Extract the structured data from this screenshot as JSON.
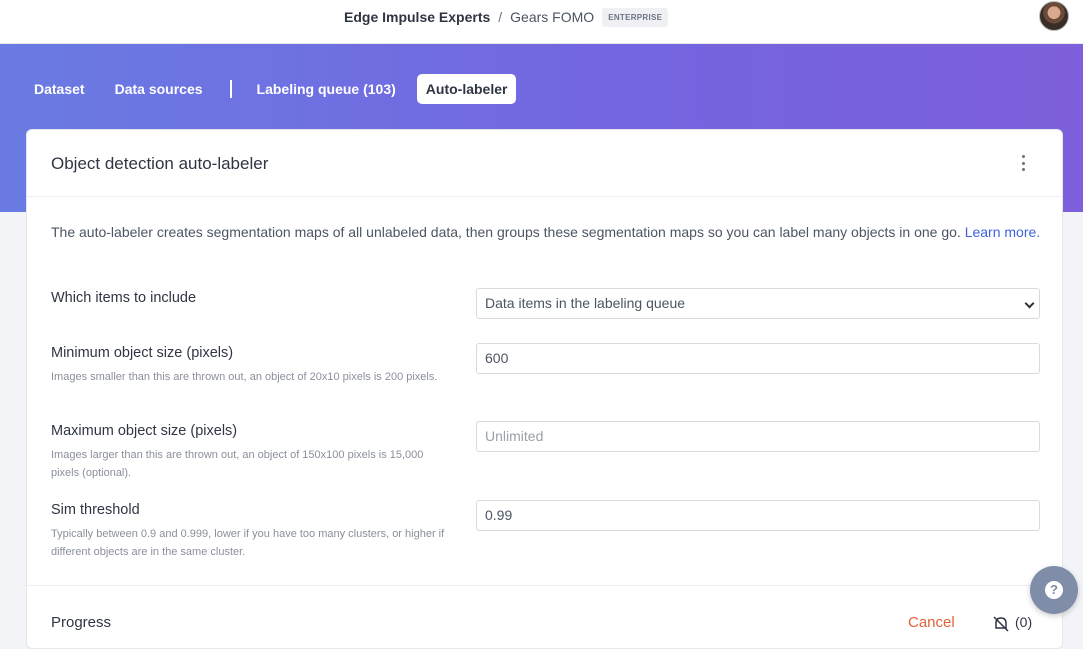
{
  "header": {
    "org_name": "Edge Impulse Experts",
    "separator": "/",
    "project_name": "Gears FOMO",
    "plan_badge": "ENTERPRISE",
    "avatar_icon": "user-avatar"
  },
  "tabs": [
    {
      "label": "Dataset",
      "active": false
    },
    {
      "label": "Data sources",
      "active": false
    },
    {
      "label": "Labeling queue (103)",
      "active": false
    },
    {
      "label": "Auto-labeler",
      "active": true
    }
  ],
  "card": {
    "title": "Object detection auto-labeler",
    "menu_icon": "kebab-menu-icon",
    "description": "The auto-labeler creates segmentation maps of all unlabeled data, then groups these segmentation maps so you can label many objects in one go.",
    "learn_more": "Learn more."
  },
  "form": {
    "include": {
      "label": "Which items to include",
      "value": "Data items in the labeling queue"
    },
    "min_size": {
      "label": "Minimum object size (pixels)",
      "help": "Images smaller than this are thrown out, an object of 20x10 pixels is 200 pixels.",
      "value": "600"
    },
    "max_size": {
      "label": "Maximum object size (pixels)",
      "help": "Images larger than this are thrown out, an object of 150x100 pixels is 15,000 pixels (optional).",
      "placeholder": "Unlimited"
    },
    "sim_threshold": {
      "label": "Sim threshold",
      "help": "Typically between 0.9 and 0.999, lower if you have too many clusters, or higher if different objects are in the same cluster.",
      "value": "0.99"
    }
  },
  "progress": {
    "label": "Progress",
    "cancel_label": "Cancel",
    "notifications_icon": "bell-off-icon",
    "notifications_count": "(0)"
  },
  "help_button": {
    "label": "?",
    "icon": "help-icon"
  },
  "colors": {
    "accent": "#3e63dd",
    "hero_start": "#6a7be3",
    "hero_end": "#7e5fdc",
    "cancel": "#e0623a"
  }
}
